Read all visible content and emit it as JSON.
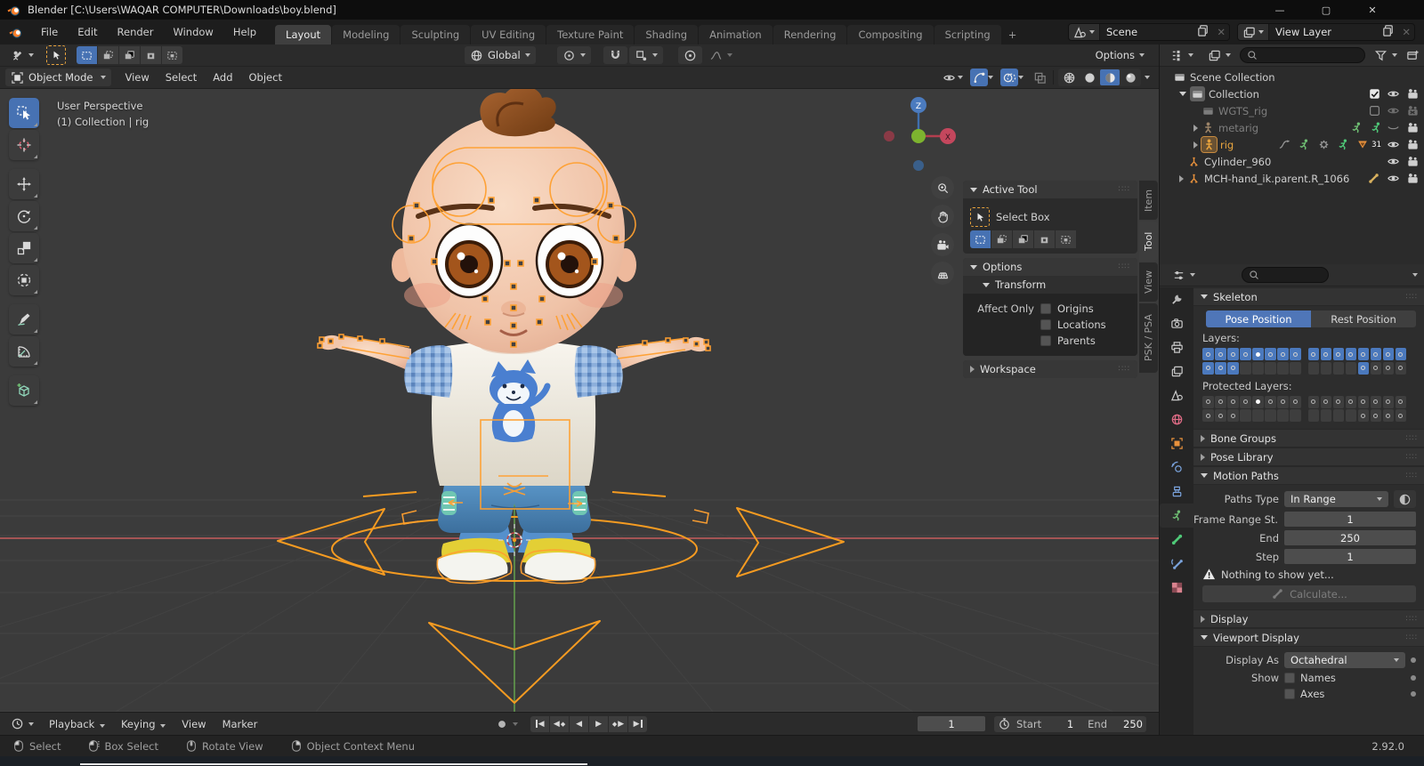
{
  "window": {
    "title": "Blender [C:\\Users\\WAQAR COMPUTER\\Downloads\\boy.blend]",
    "version": "2.92.0"
  },
  "topbar": {
    "menus": [
      "File",
      "Edit",
      "Render",
      "Window",
      "Help"
    ],
    "tabs": [
      {
        "label": "Layout",
        "active": true
      },
      {
        "label": "Mod​eling"
      },
      {
        "label": "Sculpting"
      },
      {
        "label": "UV Editing"
      },
      {
        "label": "Texture Paint"
      },
      {
        "label": "Shading"
      },
      {
        "label": "Animation"
      },
      {
        "label": "Rendering"
      },
      {
        "label": "Compositing"
      },
      {
        "label": "Scripting"
      }
    ],
    "new_tab": "+",
    "scene": {
      "label": "Scene"
    },
    "view_layer": {
      "label": "View Layer"
    }
  },
  "tool_settings": {
    "mode": "Object Mode",
    "orientation": "Global",
    "options_label": "Options",
    "select_modes": [
      "set",
      "extend",
      "subtract",
      "invert",
      "intersect"
    ]
  },
  "viewport_header": {
    "menus": [
      "View",
      "Select",
      "Add",
      "Object"
    ],
    "shading": [
      "wireframe",
      "solid",
      "material",
      "rendered"
    ],
    "shading_active": "material"
  },
  "viewport": {
    "overlay_line1": "User Perspective",
    "overlay_line2": "(1) Collection | rig",
    "gizmo_z": "Z",
    "gizmo_x": "X",
    "toolbar": [
      {
        "id": "select-box",
        "active": true
      },
      {
        "id": "cursor"
      },
      {
        "id": "move",
        "gap": true
      },
      {
        "id": "rotate"
      },
      {
        "id": "scale"
      },
      {
        "id": "transform"
      },
      {
        "id": "annotate",
        "gap": true
      },
      {
        "id": "measure"
      },
      {
        "id": "add-cube",
        "gap": true
      }
    ],
    "nav_controls": [
      "zoom",
      "pan",
      "camera",
      "ortho"
    ]
  },
  "npanel": {
    "tabs": [
      {
        "label": "Item"
      },
      {
        "label": "Tool",
        "active": true
      },
      {
        "label": "View"
      },
      {
        "label": "PSK / PSA"
      }
    ],
    "active_tool": {
      "title": "Active Tool",
      "tool_name": "Select Box"
    },
    "options": {
      "title": "Options",
      "transform": "Transform",
      "affect_only": "Affect Only",
      "checkboxes": [
        "Origins",
        "Locations",
        "Parents"
      ]
    },
    "workspace": {
      "title": "Workspace"
    }
  },
  "outliner": {
    "rows": [
      {
        "label": "Scene Collection",
        "indent": 0,
        "icon": "collection",
        "expand": "none",
        "right": []
      },
      {
        "label": "Collection",
        "indent": 1,
        "icon": "collection-boxed",
        "expand": "down",
        "right": [
          "checkbox-on",
          "eye",
          "camera"
        ]
      },
      {
        "label": "WGTS_rig",
        "indent": 2,
        "icon": "collection-grey",
        "grey": true,
        "expand": "none",
        "right": [
          "checkbox-off",
          "eye-grey",
          "camera-off"
        ]
      },
      {
        "label": "metarig",
        "indent": 2,
        "icon": "armature-grey",
        "grey": true,
        "expand": "right",
        "extras": [
          "runner",
          "runner2"
        ],
        "right": [
          "eye-closed",
          "camera"
        ]
      },
      {
        "label": "rig",
        "indent": 2,
        "icon": "armature-boxed",
        "active": true,
        "expand": "right",
        "extras": [
          "fcurve",
          "runner",
          "gear",
          "runner2",
          "badge"
        ],
        "badge": "31",
        "right": [
          "eye",
          "camera"
        ]
      },
      {
        "label": "Cylinder_960",
        "indent": 1,
        "icon": "empty-axes",
        "expand": "none",
        "right": [
          "eye",
          "camera"
        ]
      },
      {
        "label": "MCH-hand_ik.parent.R_1066",
        "indent": 1,
        "icon": "empty-axes",
        "expand": "right",
        "right": [
          "bone",
          "eye",
          "camera"
        ]
      }
    ]
  },
  "properties": {
    "tabs": [
      {
        "id": "tool"
      },
      {
        "id": "render"
      },
      {
        "id": "output"
      },
      {
        "id": "view-layer"
      },
      {
        "id": "scene"
      },
      {
        "id": "world"
      },
      {
        "id": "object"
      },
      {
        "id": "physics"
      },
      {
        "id": "constraints"
      },
      {
        "id": "object-data",
        "active": true
      },
      {
        "id": "bone"
      },
      {
        "id": "bone-constraints"
      },
      {
        "id": "texture"
      }
    ],
    "skeleton": {
      "title": "Skeleton",
      "pose_button": "Pose Position",
      "rest_button": "Rest Position",
      "layers_label": "Layers:",
      "protected_label": "Protected Layers:",
      "layers": [
        "bbbbabbb",
        "bbbeeeee",
        "bbbbbbbb",
        "eeeebggg"
      ],
      "protected": [
        "ggggwggg",
        "gggeeeee",
        "gggggggg",
        "eeeegggg"
      ]
    },
    "bone_groups": "Bone Groups",
    "pose_library": "Pose Library",
    "motion_paths": {
      "title": "Motion Paths",
      "paths_type_label": "Paths Type",
      "paths_type_value": "In Range",
      "frame_start_label": "Frame Range St...",
      "frame_start_value": "1",
      "end_label": "End",
      "end_value": "250",
      "step_label": "Step",
      "step_value": "1",
      "warning": "Nothing to show yet...",
      "calculate_label": "Calculate..."
    },
    "display": "Display",
    "viewport_display": {
      "title": "Viewport Display",
      "display_as_label": "Display As",
      "display_as_value": "Octahedral",
      "show_label": "Show",
      "names_label": "Names",
      "axes_label": "Axes"
    }
  },
  "timeline": {
    "menus": [
      "Playback",
      "Keying",
      "View",
      "Marker"
    ],
    "transport": [
      "jump-start",
      "prev-keyframe",
      "play-reverse",
      "play",
      "next-keyframe",
      "jump-end"
    ],
    "current_frame": "1",
    "start_label": "Start",
    "start_value": "1",
    "end_label": "End",
    "end_value": "250"
  },
  "statusbar": {
    "hints": [
      {
        "label": "Select",
        "mouse": "left"
      },
      {
        "label": "Box Select",
        "mouse": "left-drag"
      },
      {
        "label": "Rotate View",
        "mouse": "middle"
      },
      {
        "label": "Object Context Menu",
        "mouse": "right"
      }
    ],
    "version": "2.92.0"
  },
  "colors": {
    "accent": "#4772b3",
    "rig_orange": "#ff9d2e",
    "axis_red": "#c75d5c",
    "axis_green": "#67a84f",
    "selection_orange": "#e8a33d"
  }
}
